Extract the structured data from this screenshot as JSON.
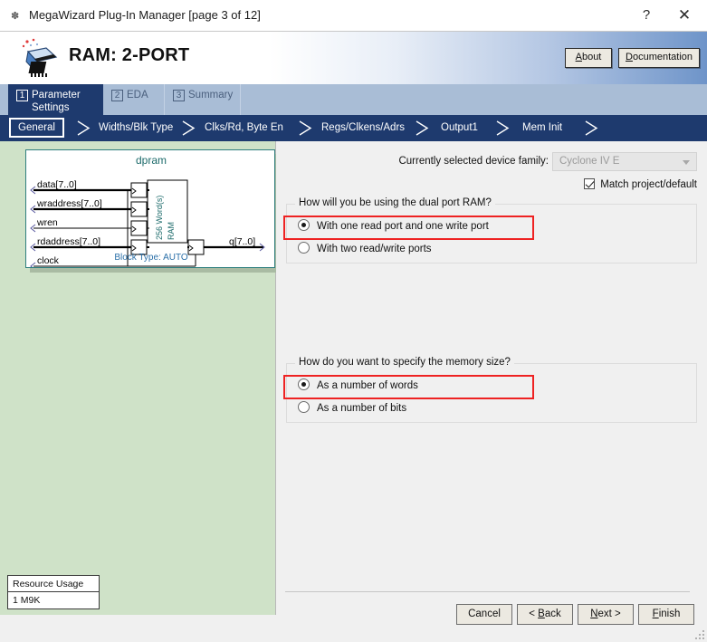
{
  "window": {
    "title": "MegaWizard Plug-In Manager [page 3 of 12]",
    "icon": "wizard-wand-icon",
    "help_label": "?",
    "close_label": "✕"
  },
  "header": {
    "product_title": "RAM: 2-PORT",
    "logo": "altera-chip-logo",
    "about_label": "About",
    "about_mnemonic": "b",
    "documentation_label": "Documentation",
    "documentation_mnemonic": "D"
  },
  "wizard_tabs": [
    {
      "num": "1",
      "label_line1": "Parameter",
      "label_line2": "Settings",
      "active": true
    },
    {
      "num": "2",
      "label_line1": "EDA",
      "label_line2": "",
      "active": false
    },
    {
      "num": "3",
      "label_line1": "Summary",
      "label_line2": "",
      "active": false
    }
  ],
  "sub_tabs": [
    {
      "label": "General",
      "active": true
    },
    {
      "label": "Widths/Blk Type",
      "active": false
    },
    {
      "label": "Clks/Rd, Byte En",
      "active": false
    },
    {
      "label": "Regs/Clkens/Adrs",
      "active": false
    },
    {
      "label": "Output1",
      "active": false
    },
    {
      "label": "Mem Init",
      "active": false
    }
  ],
  "preview": {
    "symbol_name": "dpram",
    "ram_label_line1": "256 Word(s)",
    "ram_label_line2": "RAM",
    "block_type": "Block Type: AUTO",
    "inputs": [
      "data[7..0]",
      "wraddress[7..0]",
      "wren",
      "rdaddress[7..0]",
      "clock"
    ],
    "outputs": [
      "q[7..0]"
    ],
    "resource_usage": {
      "header": "Resource Usage",
      "value": "1 M9K"
    }
  },
  "device": {
    "label": "Currently selected device family:",
    "selected_family": "Cyclone IV E",
    "combo_enabled": false,
    "match_checkbox_label": "Match project/default",
    "match_checked": true
  },
  "usage_group": {
    "title": "How will you be using the dual port RAM?",
    "options": [
      {
        "label": "With one read port and one write port",
        "selected": true,
        "highlighted": true
      },
      {
        "label": "With two read/write ports",
        "selected": false,
        "highlighted": false
      }
    ]
  },
  "memsize_group": {
    "title": "How do you want to specify the memory size?",
    "options": [
      {
        "label": "As a number of words",
        "selected": true,
        "highlighted": true
      },
      {
        "label": "As a number of bits",
        "selected": false,
        "highlighted": false
      }
    ]
  },
  "footer": {
    "cancel_label": "Cancel",
    "back_label": "< Back",
    "back_mnemonic": "B",
    "next_label": "Next >",
    "next_mnemonic": "N",
    "finish_label": "Finish",
    "finish_mnemonic": "F"
  },
  "colors": {
    "tab_active": "#1e3a6e",
    "tab_idle": "#a9bdd6",
    "preview_bg": "#cfe2c8",
    "highlight": "#ee2222",
    "symbol_accent": "#1d6b6b"
  }
}
